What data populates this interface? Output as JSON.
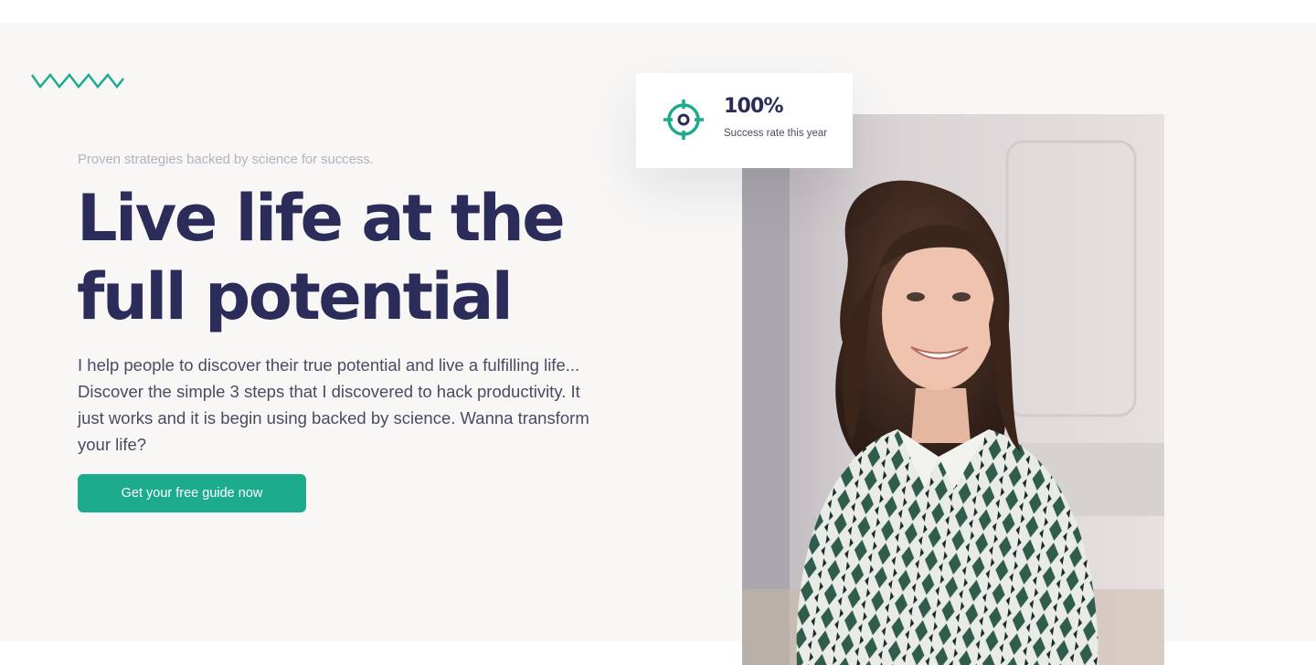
{
  "hero": {
    "eyebrow": "Proven strategies backed by science for success.",
    "headline_line1": "Live life at the",
    "headline_line2": "full potential",
    "body": "I help people to discover their true potential and live a fulfilling life... Discover the simple 3 steps that I discovered to hack productivity. It just works and it is begin using backed by science. Wanna transform your life?",
    "cta_label": "Get your free guide now"
  },
  "stat_card": {
    "icon": "target-icon",
    "value": "100%",
    "label": "Success rate this year"
  },
  "decor": {
    "zigzag_icon": "zigzag-icon",
    "photo": "portrait-photo"
  },
  "colors": {
    "accent": "#1dab8e",
    "heading": "#2c2c5a",
    "text": "#4a4a62",
    "muted": "#b3b2c0",
    "background": "#f8f7f6"
  }
}
